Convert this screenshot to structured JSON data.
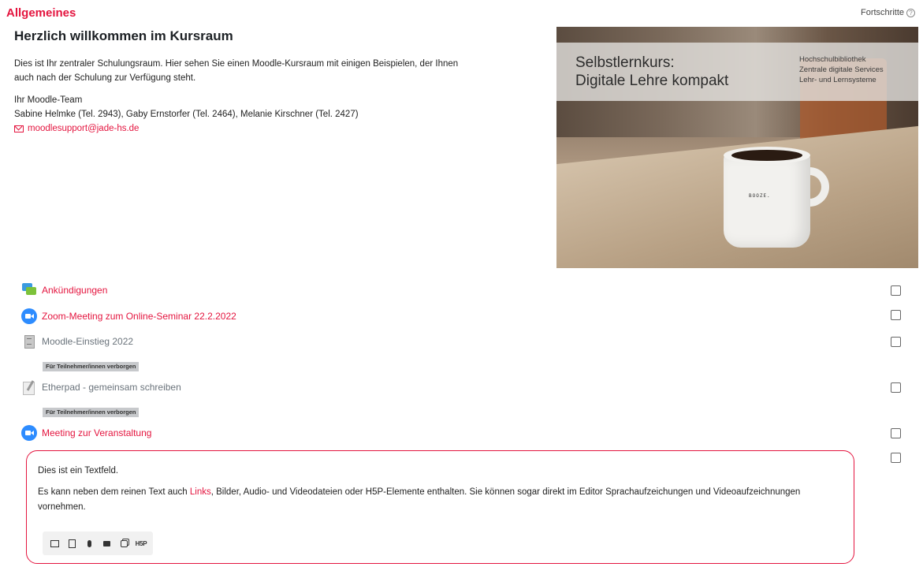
{
  "section": {
    "title": "Allgemeines",
    "progress_label": "Fortschritte"
  },
  "welcome": {
    "heading": "Herzlich willkommen im Kursraum",
    "intro_line1": "Dies ist Ihr zentraler Schulungsraum. Hier sehen Sie einen Moodle-Kursraum mit einigen Beispielen, der Ihnen",
    "intro_line2": "auch nach der Schulung zur Verfügung steht.",
    "team_label": "Ihr Moodle-Team",
    "team_members": "Sabine Helmke (Tel. 2943), Gaby Ernstorfer (Tel. 2464), Melanie Kirschner (Tel. 2427)",
    "email": "moodlesupport@jade-hs.de"
  },
  "banner": {
    "title_line1": "Selbstlernkurs:",
    "title_line2": "Digitale Lehre kompakt",
    "sub_line1": "Hochschulbibliothek",
    "sub_line2": "Zentrale digitale Services",
    "sub_line3": "Lehr- und Lernsysteme",
    "mug_text": "BOOZE."
  },
  "activities": [
    {
      "name": "Ankündigungen",
      "icon": "forum-icon",
      "hidden": false
    },
    {
      "name": "Zoom-Meeting zum Online-Seminar 22.2.2022",
      "icon": "zoom-icon",
      "hidden": false
    },
    {
      "name": "Moodle-Einstieg 2022",
      "icon": "file-icon",
      "hidden": true,
      "badge": "Für Teilnehmer/innen verborgen"
    },
    {
      "name": "Etherpad - gemeinsam schreiben",
      "icon": "etherpad-icon",
      "hidden": true,
      "badge": "Für Teilnehmer/innen verborgen"
    },
    {
      "name": "Meeting zur Veranstaltung",
      "icon": "zoom-icon",
      "hidden": false
    }
  ],
  "textfield": {
    "line1": "Dies ist ein Textfeld.",
    "para_before": "Es kann neben dem reinen Text auch ",
    "link_text": "Links",
    "para_after": ", Bilder, Audio- und Videodateien oder H5P-Elemente enthalten. Sie können sogar direkt im Editor Sprachaufzeichungen und Videoaufzeichnungen vornehmen.",
    "toolbar": [
      "image-icon",
      "document-icon",
      "microphone-icon",
      "camera-icon",
      "copy-icon"
    ],
    "h5p_label": "H5P"
  },
  "colors": {
    "accent": "#e4153f",
    "zoom": "#2d8cff"
  }
}
